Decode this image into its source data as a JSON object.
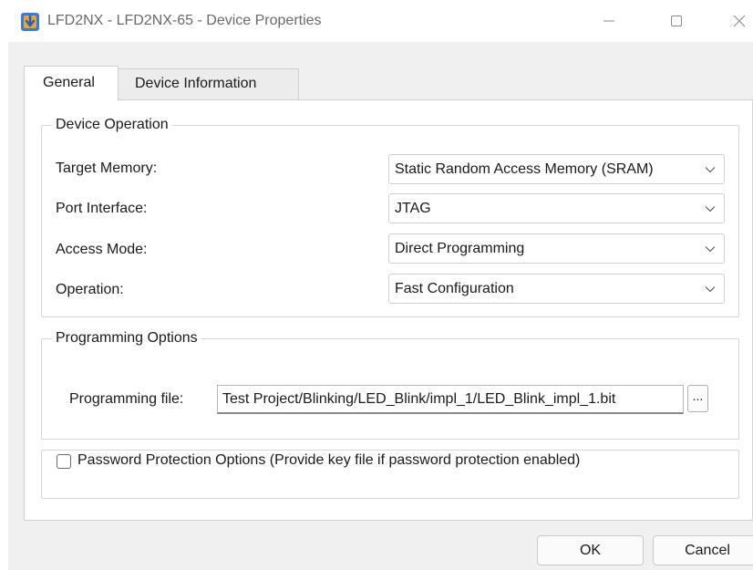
{
  "window": {
    "title": "LFD2NX - LFD2NX-65 - Device Properties",
    "icon": "programmer-app-icon",
    "controls": {
      "minimize": "minimize-icon",
      "maximize": "maximize-icon",
      "close": "close-icon"
    }
  },
  "tabs": [
    {
      "label": "General",
      "active": true
    },
    {
      "label": "Device Information",
      "active": false
    }
  ],
  "device_operation": {
    "legend": "Device Operation",
    "fields": [
      {
        "label": "Target Memory:",
        "value": "Static Random Access Memory (SRAM)"
      },
      {
        "label": "Port Interface:",
        "value": "JTAG"
      },
      {
        "label": "Access Mode:",
        "value": "Direct Programming"
      },
      {
        "label": "Operation:",
        "value": "Fast Configuration"
      }
    ]
  },
  "programming_options": {
    "legend": "Programming Options",
    "file_label": "Programming file:",
    "file_value": "Test Project/Blinking/LED_Blink/impl_1/LED_Blink_impl_1.bit",
    "browse_label": "..."
  },
  "password_options": {
    "label": "Password Protection Options (Provide key file if password protection enabled)",
    "checked": false
  },
  "buttons": {
    "ok": "OK",
    "cancel": "Cancel"
  },
  "colors": {
    "dialog_bg": "#f0f0f0",
    "panel_bg": "#ffffff",
    "icon_blue": "#3a7bd5",
    "icon_orange": "#e8a33a"
  }
}
